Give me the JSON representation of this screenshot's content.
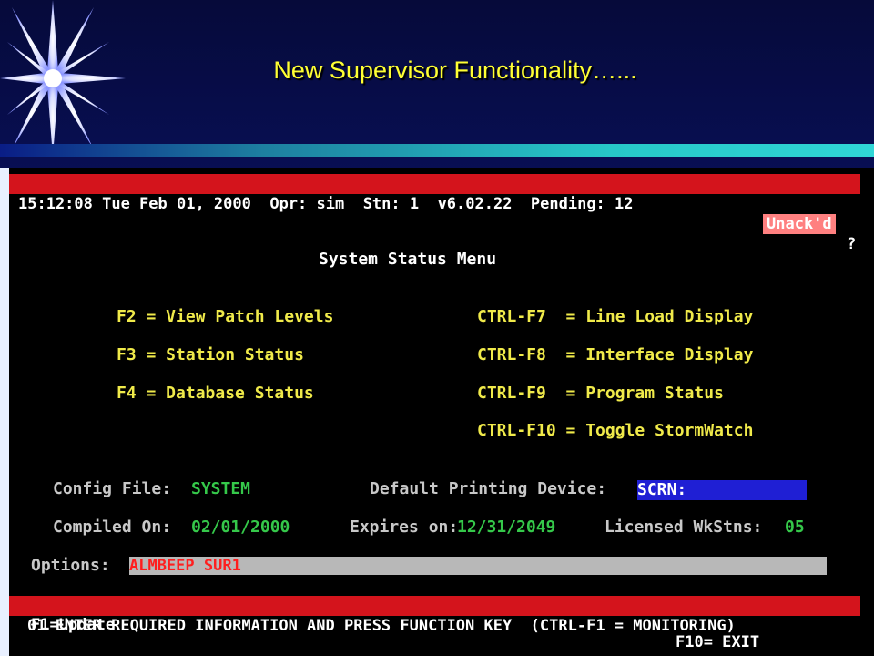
{
  "slide": {
    "title": "New Supervisor Functionality…..."
  },
  "terminal": {
    "status_bar": {
      "text": "15:12:08 Tue Feb 01, 2000  Opr: sim  Stn: 1  v6.02.22  Pending: 12",
      "unack": "Unack'd",
      "cut": "?"
    },
    "menu_title": "System Status Menu",
    "commands_left": [
      "F2 = View Patch Levels",
      "F3 = Station Status",
      "F4 = Database Status"
    ],
    "commands_right": [
      "CTRL-F7  = Line Load Display",
      "CTRL-F8  = Interface Display",
      "CTRL-F9  = Program Status",
      "CTRL-F10 = Toggle StormWatch"
    ],
    "config_file": {
      "label": "Config File:",
      "value": "SYSTEM"
    },
    "printing_device": {
      "label": "Default Printing Device:",
      "value": "SCRN:"
    },
    "compiled_on": {
      "label": "Compiled On:",
      "value": "02/01/2000"
    },
    "expires_on": {
      "label": "Expires on:",
      "value": "12/31/2049"
    },
    "licensed_wkstns": {
      "label": "Licensed WkStns:",
      "value": "05"
    },
    "options": {
      "label": "Options:",
      "value": "ALMBEEP SUR1"
    },
    "message_bar": "01 ENTER REQUIRED INFORMATION AND PRESS FUNCTION KEY  (CTRL-F1 = MONITORING)",
    "f1_key": "F1=Update",
    "f10_key": "F10= EXIT"
  },
  "colors": {
    "command": "#f0ea4a",
    "value": "#35c84a",
    "bar": "#d4141c",
    "field_blue": "#1f1fd4"
  }
}
